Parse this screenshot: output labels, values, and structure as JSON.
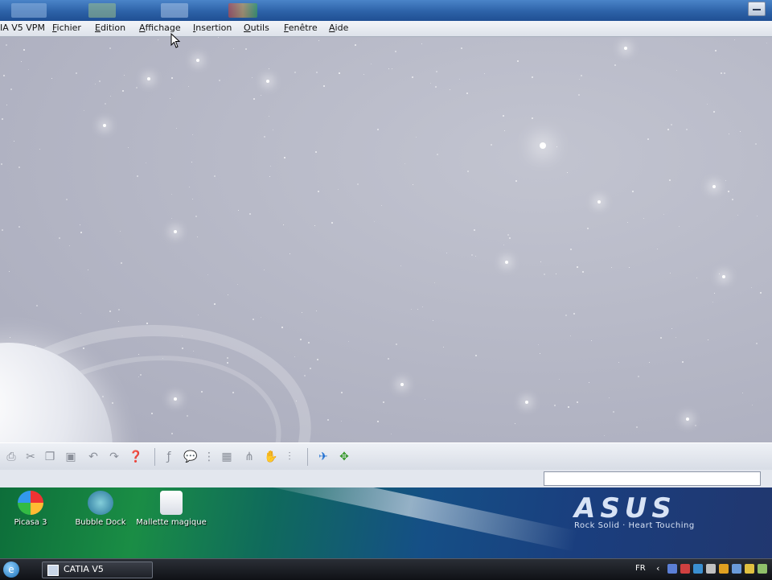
{
  "app_title_fragment": "IA V5 VPM",
  "menu": {
    "items": [
      {
        "label": "Fichier",
        "mnemonic": "F",
        "rest": "ichier"
      },
      {
        "label": "Edition",
        "mnemonic": "E",
        "rest": "dition"
      },
      {
        "label": "Affichage",
        "mnemonic": "A",
        "rest": "ffichage"
      },
      {
        "label": "Insertion",
        "mnemonic": "I",
        "rest": "nsertion"
      },
      {
        "label": "Outils",
        "mnemonic": "O",
        "rest": "utils"
      },
      {
        "label": "Fenêtre",
        "mnemonic": "F",
        "rest": "enêtre"
      },
      {
        "label": "Aide",
        "mnemonic": "A",
        "rest": "ide"
      }
    ]
  },
  "toolbar": {
    "icons": [
      "print-icon",
      "cut-icon",
      "copy-icon",
      "paste-icon",
      "undo-icon",
      "redo-icon",
      "whats-this-icon",
      "formula-icon",
      "comment-icon",
      "measure-icon",
      "table-icon",
      "tree-icon",
      "hand-icon",
      "align-icon",
      "compass-icon",
      "fit-all-icon"
    ]
  },
  "desktop": {
    "icons": [
      {
        "label": "Picasa 3",
        "icon": "picasa-icon"
      },
      {
        "label": "Bubble Dock",
        "icon": "bubble-dock-icon"
      },
      {
        "label": "Mallette magique",
        "icon": "briefcase-icon"
      }
    ],
    "brand": {
      "logo": "ASUS",
      "tagline": "Rock Solid · Heart Touching"
    }
  },
  "taskbar": {
    "task_label": "CATIA V5",
    "language": "FR"
  },
  "colors": {
    "title_bar": "#2d62a8",
    "workspace": "#b3b5c4",
    "accent": "#1f6fd1"
  }
}
